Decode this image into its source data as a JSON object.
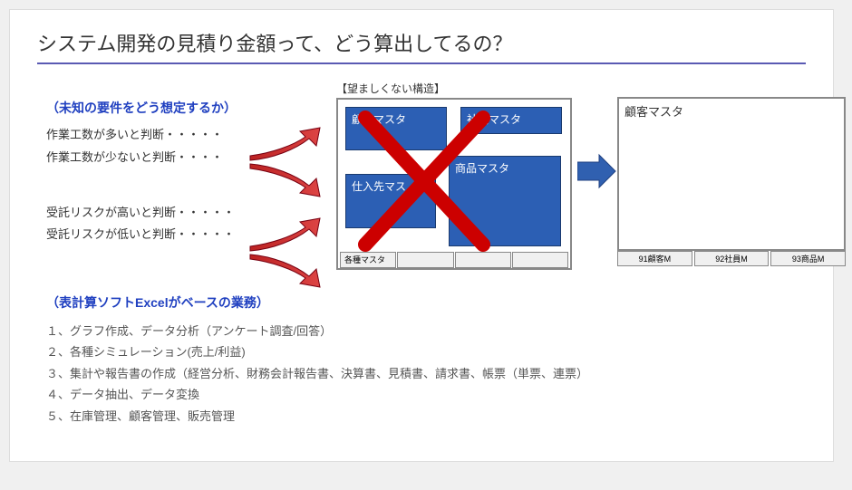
{
  "title": "システム開発の見積り金額って、どう算出してるの？",
  "left": {
    "heading1": "（未知の要件をどう想定するか）",
    "items1": [
      "作業工数が多いと判断・・・・・",
      "作業工数が少ないと判断・・・・"
    ],
    "items2": [
      "受託リスクが高いと判断・・・・・",
      "受託リスクが低いと判断・・・・・"
    ]
  },
  "diagram1": {
    "label": "【望ましくない構造】",
    "b1": "顧客マスタ",
    "b2": "社員マスタ",
    "b3": "仕入先マス",
    "b4": "商品マスタ",
    "tab1": "各種マスタ"
  },
  "diagram2": {
    "text": "顧客マスタ",
    "tabs": [
      "91顧客M",
      "92社員M",
      "93商品M"
    ]
  },
  "excel": {
    "heading": "（表計算ソフトExcelがベースの業務）",
    "items": [
      "１、グラフ作成、データ分析（アンケート調査/回答）",
      "２、各種シミュレーション(売上/利益)",
      "３、集計や報告書の作成（経営分析、財務会計報告書、決算書、見積書、請求書、帳票（単票、連票）",
      "４、データ抽出、データ変換",
      "５、在庫管理、顧客管理、販売管理"
    ]
  }
}
